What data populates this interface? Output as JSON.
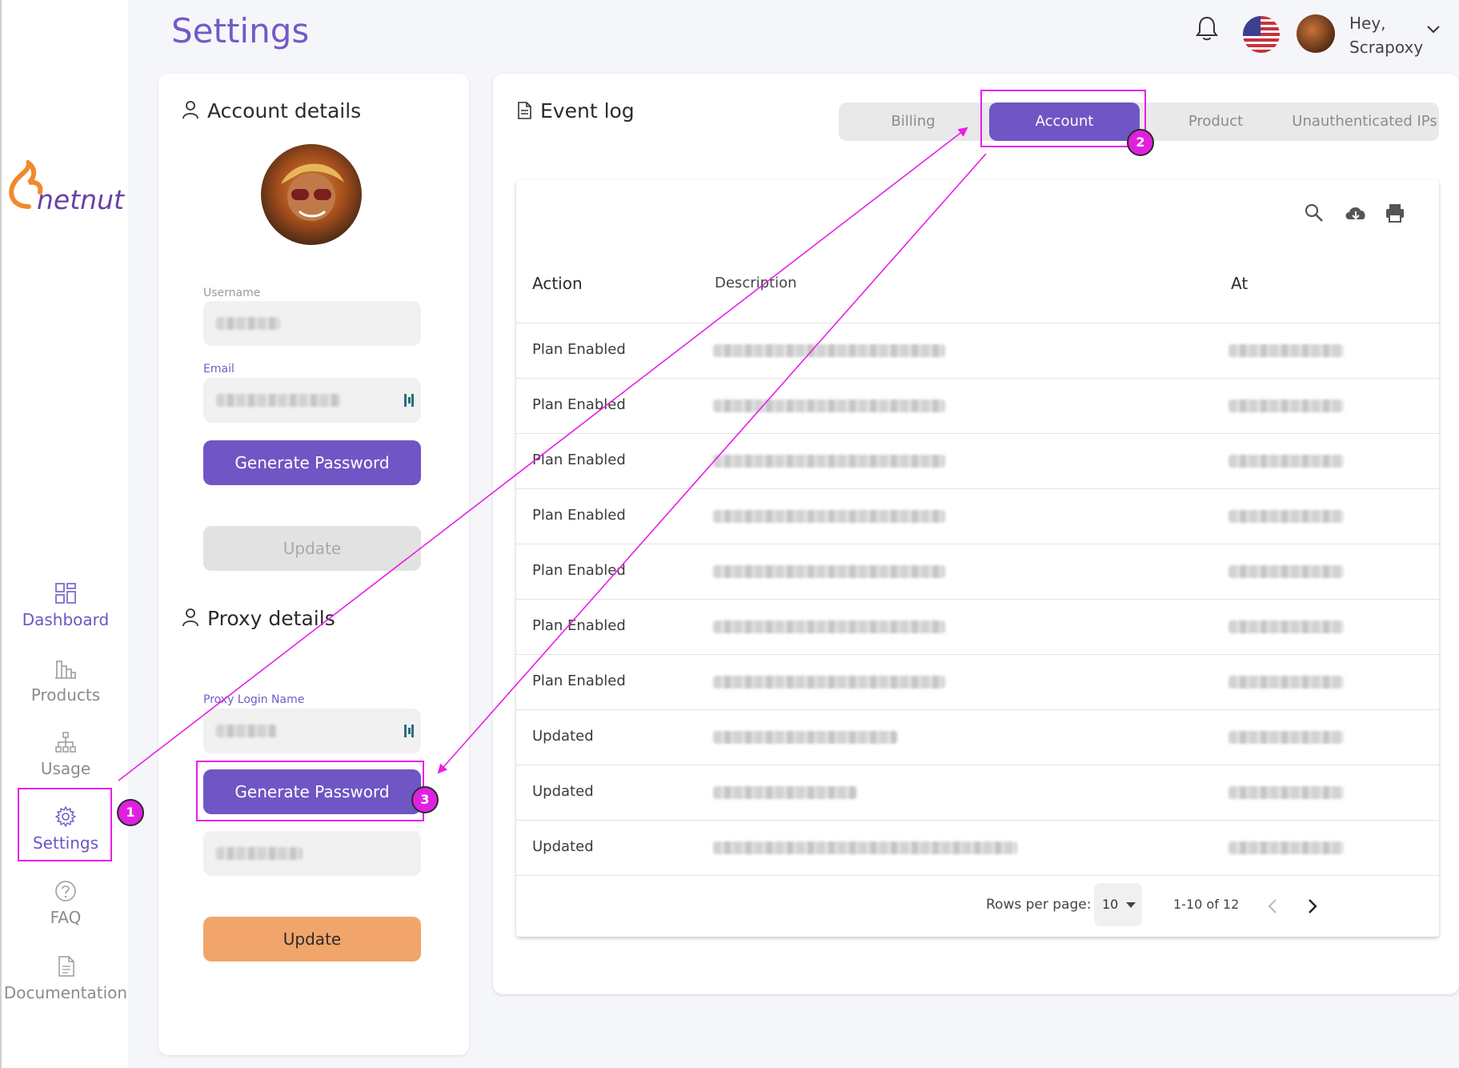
{
  "page": {
    "title": "Settings"
  },
  "header": {
    "greeting_line1": "Hey,",
    "greeting_line2": "Scrapoxy"
  },
  "logo": {
    "text": "netnut"
  },
  "sidebar": {
    "items": [
      {
        "label": "Dashboard",
        "icon": "dashboard-icon"
      },
      {
        "label": "Products",
        "icon": "products-icon"
      },
      {
        "label": "Usage",
        "icon": "usage-icon"
      },
      {
        "label": "Settings",
        "icon": "gear-icon"
      },
      {
        "label": "FAQ",
        "icon": "help-icon"
      },
      {
        "label": "Documentation",
        "icon": "document-icon"
      }
    ]
  },
  "account": {
    "title": "Account details",
    "username_label": "Username",
    "email_label": "Email",
    "generate_label": "Generate Password",
    "update_label": "Update"
  },
  "proxy": {
    "title": "Proxy details",
    "login_label": "Proxy Login Name",
    "generate_label": "Generate Password",
    "update_label": "Update"
  },
  "eventlog": {
    "title": "Event log",
    "tabs": [
      "Billing",
      "Account",
      "Product",
      "Unauthenticated IPs"
    ],
    "active_tab": "Account",
    "columns": {
      "action": "Action",
      "description": "Description",
      "at": "At"
    },
    "rows": [
      {
        "action": "Plan Enabled"
      },
      {
        "action": "Plan Enabled"
      },
      {
        "action": "Plan Enabled"
      },
      {
        "action": "Plan Enabled"
      },
      {
        "action": "Plan Enabled"
      },
      {
        "action": "Plan Enabled"
      },
      {
        "action": "Plan Enabled"
      },
      {
        "action": "Updated"
      },
      {
        "action": "Updated"
      },
      {
        "action": "Updated"
      }
    ],
    "footer": {
      "rows_per_page_label": "Rows per page:",
      "rows_per_page": "10",
      "range": "1-10 of 12"
    }
  },
  "annotations": [
    "1",
    "2",
    "3"
  ],
  "colors": {
    "accent": "#6f56c4",
    "highlight": "#e81ee8",
    "orange": "#f1a56a"
  }
}
